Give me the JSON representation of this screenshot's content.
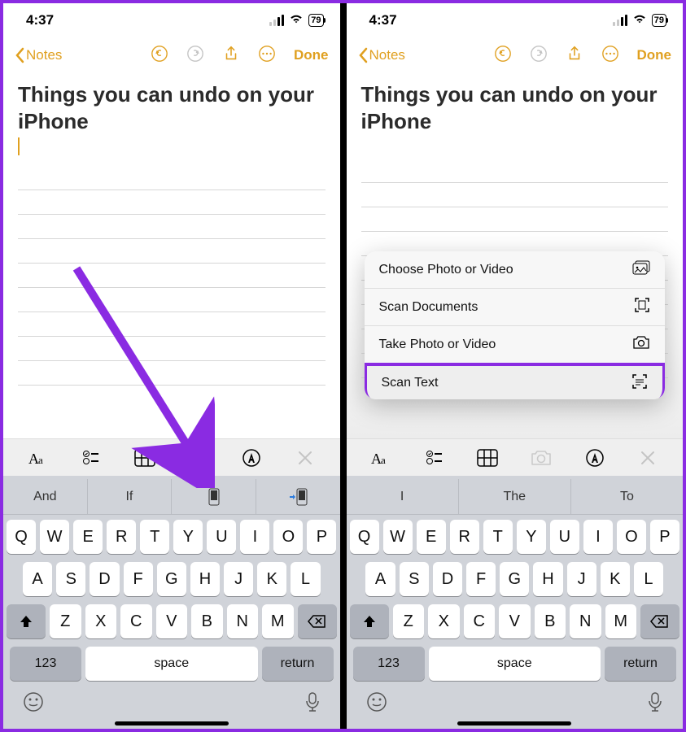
{
  "status": {
    "time": "4:37",
    "battery": "79"
  },
  "nav": {
    "back": "Notes",
    "done": "Done"
  },
  "note": {
    "title": "Things you can undo on your iPhone"
  },
  "suggestionsA": [
    "And",
    "If",
    "",
    ""
  ],
  "suggestionsB": [
    "I",
    "The",
    "To"
  ],
  "rows": {
    "r1": [
      "Q",
      "W",
      "E",
      "R",
      "T",
      "Y",
      "U",
      "I",
      "O",
      "P"
    ],
    "r2": [
      "A",
      "S",
      "D",
      "F",
      "G",
      "H",
      "J",
      "K",
      "L"
    ],
    "r3": [
      "Z",
      "X",
      "C",
      "V",
      "B",
      "N",
      "M"
    ]
  },
  "keys": {
    "num": "123",
    "space": "space",
    "return": "return"
  },
  "menu": [
    {
      "label": "Choose Photo or Video"
    },
    {
      "label": "Scan Documents"
    },
    {
      "label": "Take Photo or Video"
    },
    {
      "label": "Scan Text"
    }
  ]
}
